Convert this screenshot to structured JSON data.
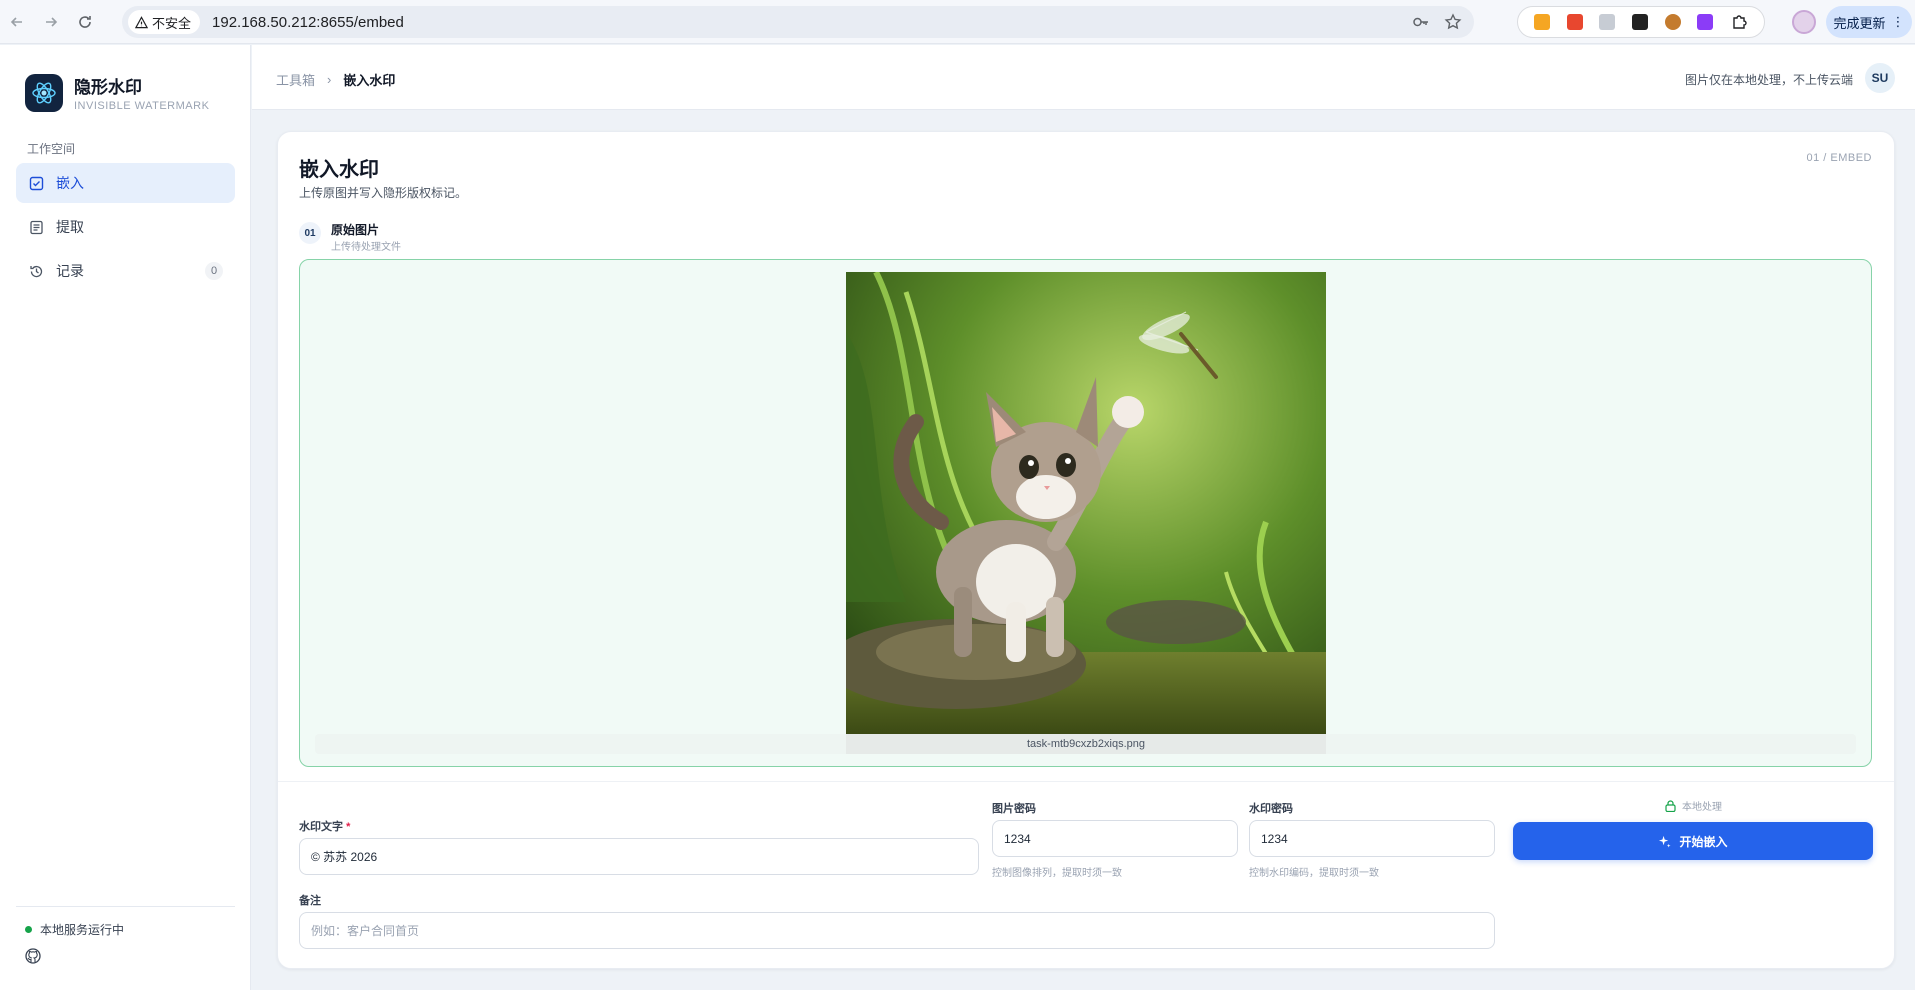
{
  "browser": {
    "insecure_label": "不安全",
    "url": "192.168.50.212:8655/embed",
    "update_label": "完成更新"
  },
  "sidebar": {
    "brand_title": "隐形水印",
    "brand_subtitle": "INVISIBLE WATERMARK",
    "section_label": "工作空间",
    "items": [
      {
        "label": "嵌入",
        "icon": "checkbox-icon",
        "active": true
      },
      {
        "label": "提取",
        "icon": "document-icon"
      },
      {
        "label": "记录",
        "icon": "history-icon",
        "badge": "0"
      }
    ],
    "status_text": "本地服务运行中"
  },
  "header": {
    "breadcrumb_root": "工具箱",
    "breadcrumb_current": "嵌入水印",
    "notice": "图片仅在本地处理，不上传云端",
    "avatar": "SU"
  },
  "card": {
    "title": "嵌入水印",
    "description": "上传原图并写入隐形版权标记。",
    "step_tag": "01 / EMBED",
    "step": {
      "number": "01",
      "title": "原始图片",
      "subtitle": "上传待处理文件"
    },
    "file_name": "task-mtb9cxzb2xiqs.png"
  },
  "form": {
    "watermark_text_label": "水印文字",
    "required_mark": "*",
    "watermark_text_value": "© 苏苏 2026",
    "image_key_label": "图片密码",
    "image_key_value": "1234",
    "image_key_hint": "控制图像排列，提取时须一致",
    "watermark_key_label": "水印密码",
    "watermark_key_value": "1234",
    "watermark_key_hint": "控制水印编码，提取时须一致",
    "note_label": "备注",
    "note_placeholder": "例如：客户合同首页",
    "local_label": "本地处理",
    "submit_label": "开始嵌入"
  },
  "colors": {
    "primary": "#2563eb",
    "dropzone_border": "#86d3a8",
    "status_dot": "#16a34a"
  }
}
